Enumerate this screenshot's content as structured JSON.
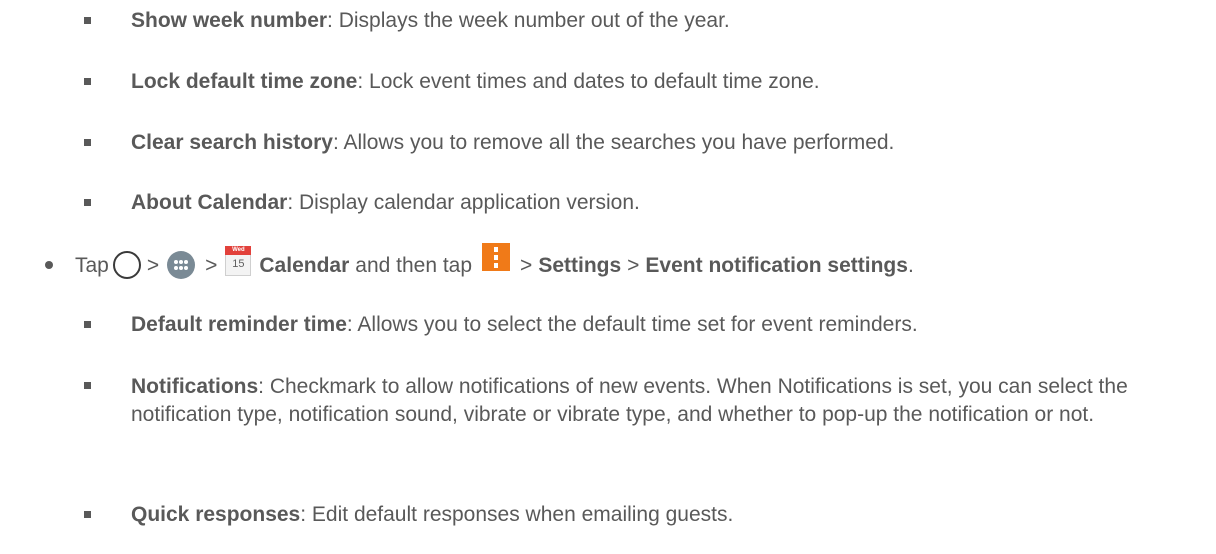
{
  "settings_items": [
    {
      "term": "Show week number",
      "desc": ": Displays the week number out of the year."
    },
    {
      "term": "Lock default time zone",
      "desc": ": Lock event times and dates to default time zone."
    },
    {
      "term": "Clear search history",
      "desc": ": Allows you to remove all the searches you have performed."
    },
    {
      "term": "About Calendar",
      "desc": ": Display calendar application version."
    }
  ],
  "step": {
    "tap_word": "Tap",
    "sep1": ">",
    "sep2": ">",
    "calendar_icon_top": "Wed",
    "calendar_icon_day": "15",
    "calendar_label": "Calendar",
    "then_tap": "and then tap",
    "sep3": ">",
    "settings_label": "Settings",
    "sep4": ">",
    "event_notification_label": "Event notification settings",
    "end_period": "."
  },
  "notification_items": [
    {
      "term": "Default reminder time",
      "desc": ": Allows you to select the default time set for event reminders."
    },
    {
      "term": "Notifications",
      "desc": ": Checkmark to allow notifications of new events. When Notifications is set, you can select the notification type, notification sound, vibrate or vibrate type, and whether to pop-up the notification or not."
    },
    {
      "term": "Quick responses",
      "desc": ": Edit default responses when emailing guests."
    }
  ],
  "colors": {
    "text": "#595959",
    "menu_icon": "#f07a18",
    "calendar_icon_header": "#e2413b",
    "apps_icon": "#7a8a95"
  },
  "icons": [
    "home-icon",
    "apps-icon",
    "calendar-icon",
    "menu-icon"
  ]
}
